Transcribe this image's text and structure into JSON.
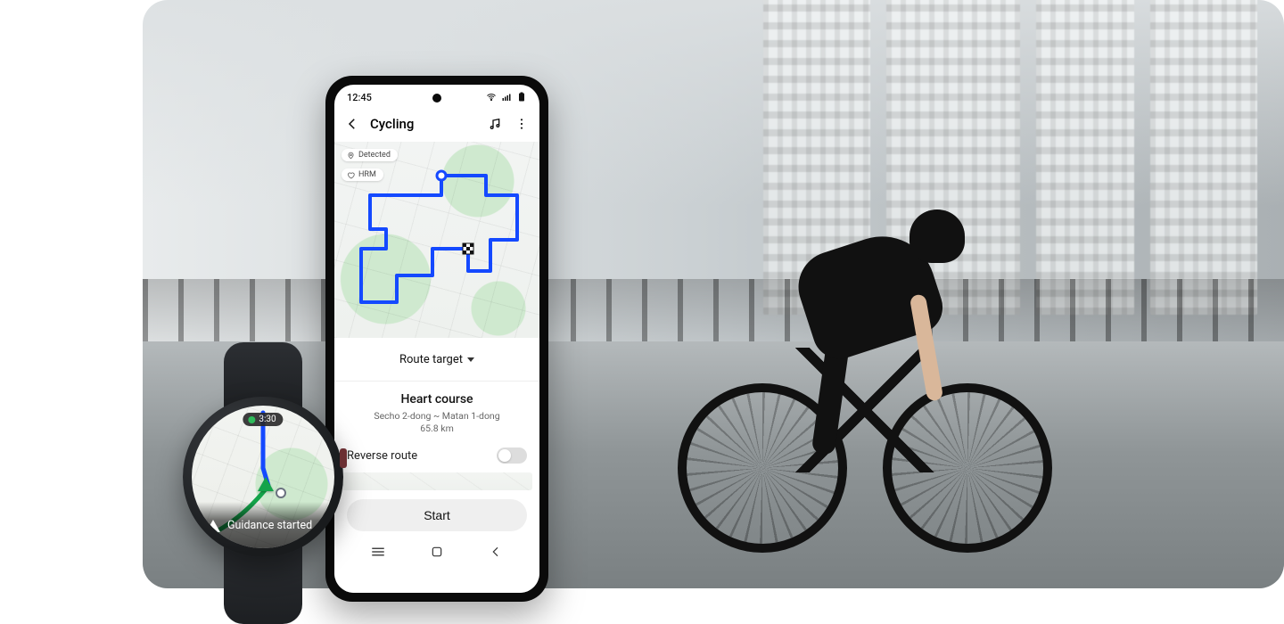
{
  "phone": {
    "status": {
      "time": "12:45"
    },
    "header": {
      "title": "Cycling"
    },
    "mapChips": {
      "detected": "Detected",
      "hrm": "HRM"
    },
    "sheet": {
      "routeTargetLabel": "Route target",
      "course": {
        "name": "Heart course",
        "subtitle": "Secho 2-dong ~ Matan 1-dong",
        "distance": "65.8 km"
      },
      "reverseLabel": "Reverse route",
      "reverseOn": false,
      "startLabel": "Start"
    }
  },
  "watch": {
    "pillTime": "3:30",
    "banner": "Guidance started"
  }
}
